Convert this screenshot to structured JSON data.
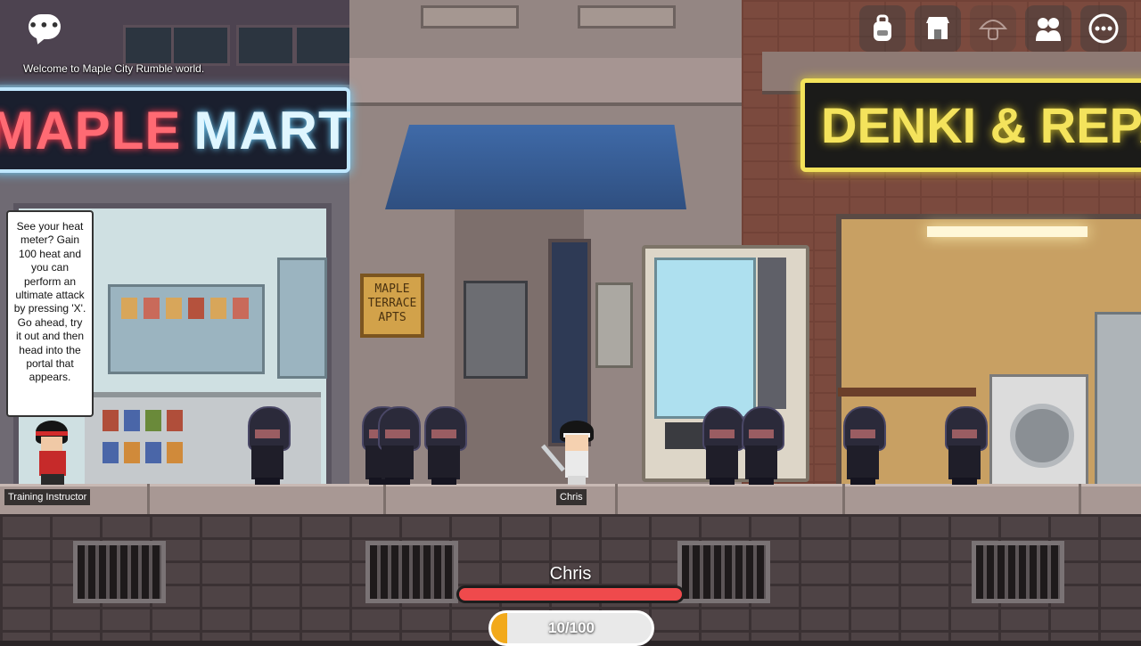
{
  "game": {
    "location_message": "Welcome to Maple City Rumble world."
  },
  "signs": {
    "maple_mart_a": "MAPLE",
    "maple_mart_b": "MART",
    "denki": "DENKI & REPAIR",
    "apts_line1": "MAPLE",
    "apts_line2": "TERRACE",
    "apts_line3": "APTS"
  },
  "toolbar": {
    "icons": [
      "chat-icon",
      "backpack-icon",
      "shop-icon",
      "mushroom-icon",
      "friends-icon",
      "more-icon"
    ],
    "mushroom_disabled": true
  },
  "tutorial": {
    "text": "See your heat meter? Gain 100 heat and you can perform an ultimate attack by pressing 'X'. Go ahead, try it out and then head into the portal that appears."
  },
  "npc": {
    "name": "Training Instructor"
  },
  "player": {
    "name_tag": "Chris",
    "hud_name": "Chris",
    "hp_fraction": 1.0,
    "heat_text": "10/100",
    "heat_fraction": 0.1
  },
  "colors": {
    "hp": "#ef4a4c",
    "heat": "#f2a91b",
    "maple_sign_red": "#ff6a73",
    "maple_sign_white": "#dff6ff",
    "denki_sign": "#f4e35c"
  },
  "enemies": {
    "count": 9,
    "type": "hooded-ninja"
  }
}
